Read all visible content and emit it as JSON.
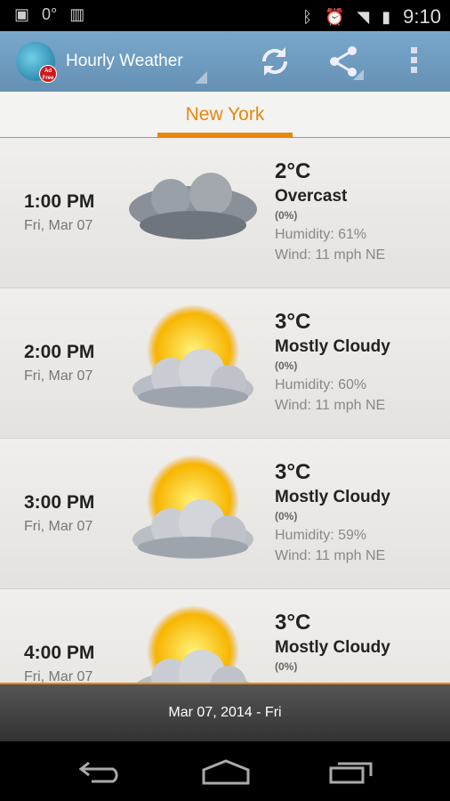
{
  "status_bar": {
    "temp": "0°",
    "time": "9:10",
    "icons": [
      "image-icon",
      "barcode-icon",
      "bluetooth-icon",
      "alarm-icon",
      "wifi-icon",
      "signal-icon",
      "battery-charging-icon"
    ]
  },
  "app_bar": {
    "title": "Hourly Weather",
    "badge": "Ad Free",
    "actions": [
      "refresh-icon",
      "share-icon",
      "overflow-menu-icon"
    ]
  },
  "tabs": [
    {
      "label": "New York",
      "active": true
    }
  ],
  "accent": "#e8870e",
  "hours": [
    {
      "time": "1:00 PM",
      "date": "Fri, Mar 07",
      "temp": "2°C",
      "condition": "Overcast",
      "precip": "(0%)",
      "humidity": "Humidity: 61%",
      "wind": "Wind: 11 mph NE",
      "icon": "overcast-icon"
    },
    {
      "time": "2:00 PM",
      "date": "Fri, Mar 07",
      "temp": "3°C",
      "condition": "Mostly Cloudy",
      "precip": "(0%)",
      "humidity": "Humidity: 60%",
      "wind": "Wind: 11 mph NE",
      "icon": "mostly-cloudy-icon"
    },
    {
      "time": "3:00 PM",
      "date": "Fri, Mar 07",
      "temp": "3°C",
      "condition": "Mostly Cloudy",
      "precip": "(0%)",
      "humidity": "Humidity: 59%",
      "wind": "Wind: 11 mph NE",
      "icon": "mostly-cloudy-icon"
    },
    {
      "time": "4:00 PM",
      "date": "Fri, Mar 07",
      "temp": "3°C",
      "condition": "Mostly Cloudy",
      "precip": "(0%)",
      "icon": "mostly-cloudy-icon"
    }
  ],
  "footer": {
    "date": "Mar 07, 2014 - Fri"
  }
}
